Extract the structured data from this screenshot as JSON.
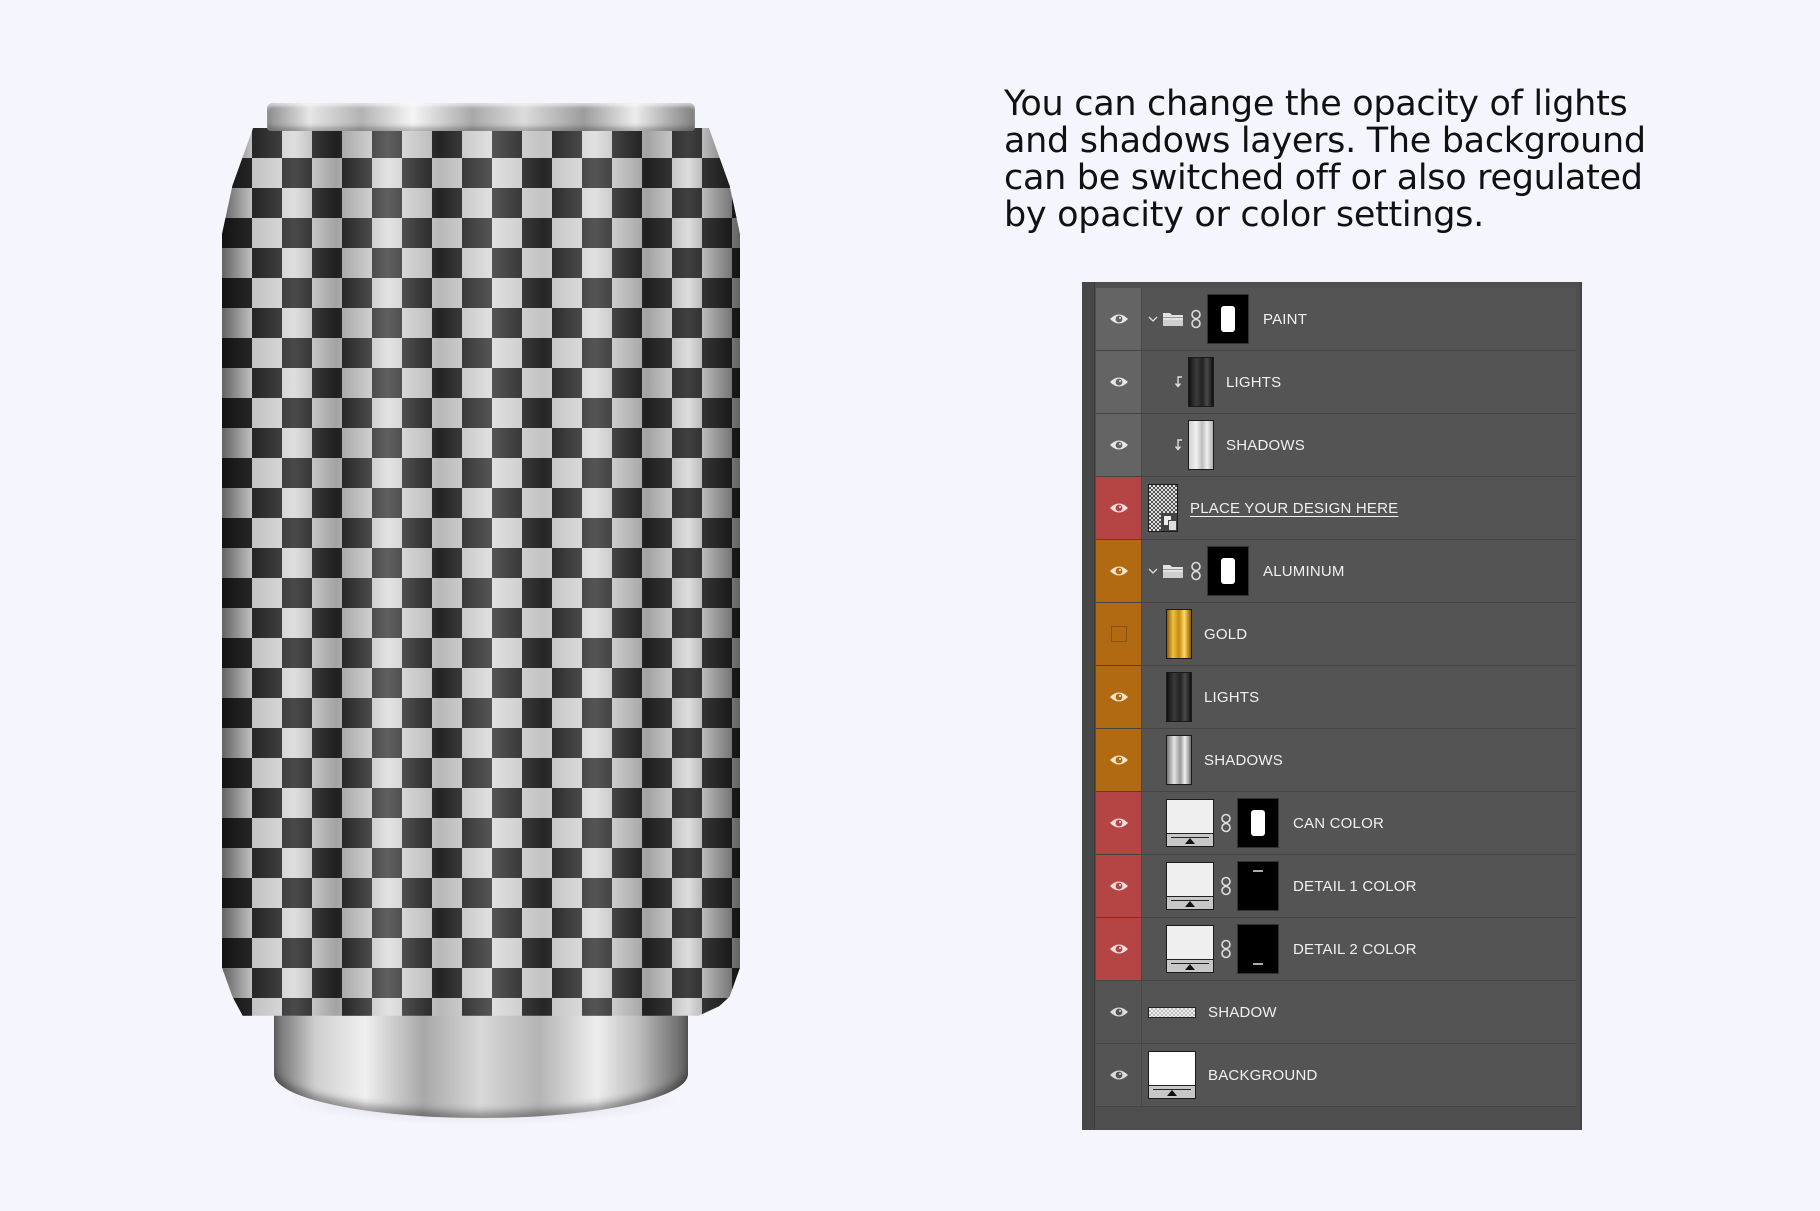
{
  "description": "You can change the opacity of lights\nand shadows layers. The background\ncan be switched off or also regulated\nby opacity or color settings.",
  "mockup": {
    "subject": "aluminum soda can",
    "pattern": "checkerboard"
  },
  "colors": {
    "page_background": "#f5f6fd",
    "panel_background": "#545454",
    "tag_red": "#b54545",
    "tag_orange": "#b16a12",
    "tag_gray": "#646464"
  },
  "layers": [
    {
      "name": "PAINT",
      "type": "group",
      "expanded": true,
      "visible": true,
      "color_tag": "gray",
      "linked_mask": true,
      "indent": 0
    },
    {
      "name": "LIGHTS",
      "type": "clipped-layer",
      "visible": true,
      "color_tag": "gray",
      "thumbnail": "dark-can",
      "indent": 1
    },
    {
      "name": "SHADOWS",
      "type": "clipped-layer",
      "visible": true,
      "color_tag": "gray",
      "thumbnail": "light-can",
      "indent": 1
    },
    {
      "name": "PLACE YOUR DESIGN HERE",
      "type": "smart-object",
      "visible": true,
      "color_tag": "red",
      "underlined": true,
      "indent": 0
    },
    {
      "name": "ALUMINUM",
      "type": "group",
      "expanded": true,
      "visible": true,
      "color_tag": "orange",
      "linked_mask": true,
      "indent": 0
    },
    {
      "name": "GOLD",
      "type": "layer",
      "visible": false,
      "color_tag": "orange",
      "thumbnail": "gold-can",
      "indent": 1
    },
    {
      "name": "LIGHTS",
      "type": "layer",
      "visible": true,
      "color_tag": "orange",
      "thumbnail": "dark-can",
      "indent": 1
    },
    {
      "name": "SHADOWS",
      "type": "layer",
      "visible": true,
      "color_tag": "orange",
      "thumbnail": "silver-can",
      "indent": 1
    },
    {
      "name": "CAN COLOR",
      "type": "fill-layer",
      "visible": true,
      "color_tag": "red",
      "mask": "can-shape",
      "indent": 1
    },
    {
      "name": "DETAIL 1 COLOR",
      "type": "fill-layer",
      "visible": true,
      "color_tag": "red",
      "mask": "top-line",
      "indent": 1
    },
    {
      "name": "DETAIL 2 COLOR",
      "type": "fill-layer",
      "visible": true,
      "color_tag": "red",
      "mask": "bottom-line",
      "indent": 1
    },
    {
      "name": "SHADOW",
      "type": "layer",
      "visible": true,
      "color_tag": "none",
      "thumbnail": "shadow-strip",
      "indent": 0
    },
    {
      "name": "BACKGROUND",
      "type": "fill-layer",
      "visible": true,
      "color_tag": "none",
      "thumbnail": "white-fill",
      "indent": 0
    }
  ]
}
